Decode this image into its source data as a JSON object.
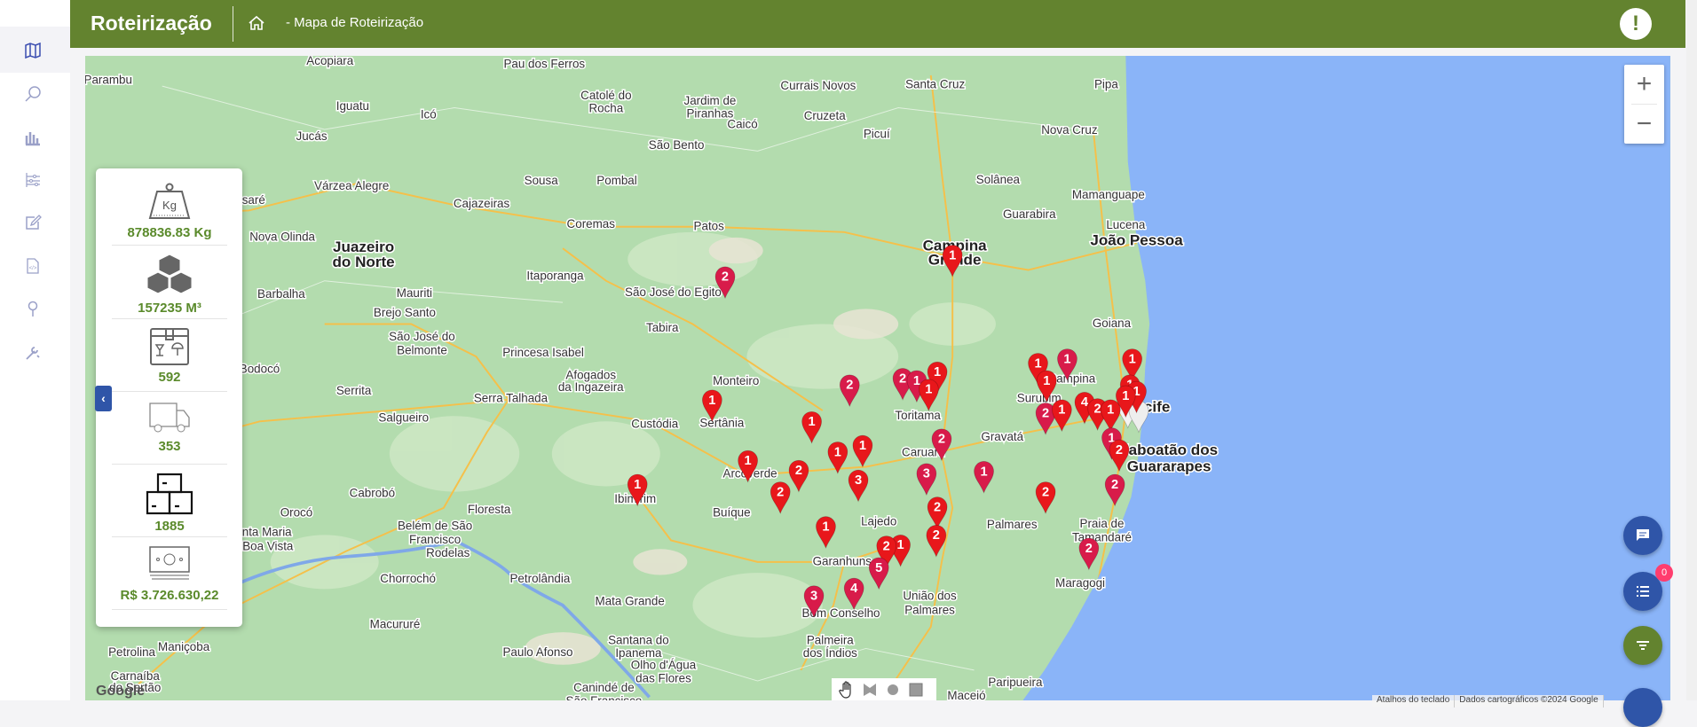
{
  "header": {
    "title": "Roteirização",
    "breadcrumb": "- Mapa de Roteirização",
    "alert_label": "!"
  },
  "sidebar": {
    "items": [
      {
        "icon": "map-icon",
        "active": true
      },
      {
        "icon": "search-icon"
      },
      {
        "icon": "bar-chart-icon"
      },
      {
        "icon": "sliders-icon"
      },
      {
        "icon": "edit-icon"
      },
      {
        "icon": "code-file-icon"
      },
      {
        "icon": "pin-icon"
      },
      {
        "icon": "tools-icon"
      }
    ]
  },
  "summary": {
    "weight": "878836.83  Kg",
    "weight_icon_text": "Kg",
    "volume": "157235  M³",
    "packages": "592",
    "vehicles": "353",
    "items": "1885",
    "value": "R$ 3.726.630,22",
    "collapse_label": "‹"
  },
  "map": {
    "zoom_in": "+",
    "zoom_out": "−",
    "google": "Google",
    "attribution": [
      "Atalhos do teclado",
      "Dados cartográficos ©2024 Google"
    ],
    "labels": [
      "Acopiara",
      "Pau dos Ferros",
      "Currais Novos",
      "Santa Cruz",
      "Pipa",
      "Iguatu",
      "Icó",
      "Catolé do",
      "Rocha",
      "Jardim de",
      "Piranhas",
      "Cruzeta",
      "Nova Cruz",
      "Caicó",
      "Picuí",
      "Jucás",
      "São Bento",
      "Várzea Alegre",
      "Sousa",
      "Pombal",
      "Solânea",
      "Mamanguape",
      "Cajazeiras",
      "Coremas",
      "Patos",
      "Guarabira",
      "Nova Olinda",
      "Lucena",
      "Itaporanga",
      "Barbalha",
      "Mauriti",
      "Brejo Santo",
      "São José do Egito",
      "Tabira",
      "Princesa Isabel",
      "Goiana",
      "São José do",
      "Belmonte",
      "Bodocó",
      "Afogados",
      "da Ingazeira",
      "Monteiro",
      "Toritama",
      "Serrita",
      "Serra Talhada",
      "Salgueiro",
      "Custódia",
      "Sertânia",
      "Gravatá",
      "Caruaru",
      "Arcoverde",
      "Cabrobó",
      "Floresta",
      "Ibimirim",
      "Buíque",
      "Palmares",
      "Lajedo",
      "Belém de São",
      "Francisco",
      "Orocó",
      "Santa Maria",
      "da Boa Vista",
      "Rodelas",
      "Praia de",
      "Tamandaré",
      "Garanhuns",
      "Chorrochó",
      "Petrolândia",
      "Maragogi",
      "União dos",
      "Palmares",
      "Mata Grande",
      "Macururé",
      "Bom Conselho",
      "Santana do",
      "Ipanema",
      "Paulo Afonso",
      "Olho d'Água",
      "das Flores",
      "Palmeira",
      "dos Índios",
      "Maniçoba",
      "Petrolina",
      "Carnaíba",
      "do Sertão",
      "Canindé de",
      "São Francisco",
      "Paripueira",
      "Maceió",
      "Surubim",
      "Campina",
      "Sassaré",
      "Parambu"
    ],
    "big_labels": [
      "Juazeiro",
      "do Norte",
      "João Pessoa",
      "Campina",
      "Grande",
      "Recife",
      "Jaboatão dos",
      "Guararapes"
    ],
    "markers": [
      1,
      2,
      1,
      1,
      1,
      1,
      2,
      2,
      1,
      1,
      1,
      1,
      1,
      2,
      1,
      4,
      2,
      1,
      1,
      1,
      2,
      1,
      2,
      2,
      3,
      3,
      1,
      1,
      1,
      2,
      2,
      2,
      2,
      2,
      1,
      1,
      2,
      5,
      2,
      3,
      4,
      1,
      1,
      1
    ],
    "colors": {
      "red": "#e8171b",
      "crimson": "#d81b4a",
      "land": "#b3dcae",
      "ocean": "#8ab4f8",
      "road": "#f5c04a"
    }
  },
  "fabs": {
    "chat_icon": "chat-icon",
    "list_icon": "list-icon",
    "filter_icon": "filter-icon",
    "list_badge": "0"
  }
}
